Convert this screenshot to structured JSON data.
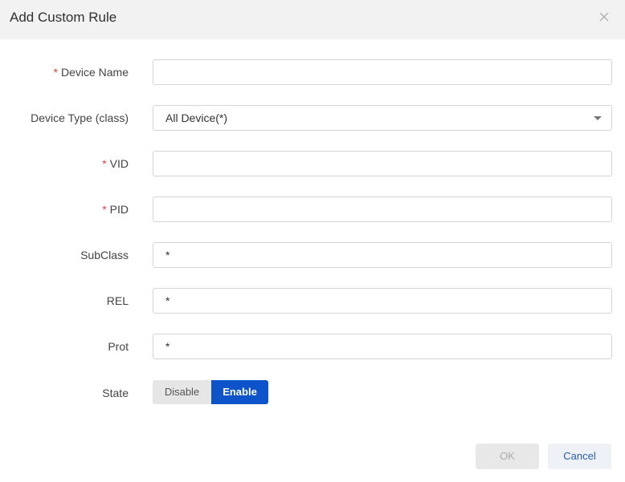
{
  "dialog": {
    "title": "Add Custom Rule"
  },
  "fields": {
    "device_name": {
      "label": "Device Name",
      "required_mark": "*",
      "value": ""
    },
    "device_type": {
      "label": "Device Type (class)",
      "value": "All Device(*)"
    },
    "vid": {
      "label": "VID",
      "required_mark": "*",
      "value": ""
    },
    "pid": {
      "label": "PID",
      "required_mark": "*",
      "value": ""
    },
    "subclass": {
      "label": "SubClass",
      "value": "*"
    },
    "rel": {
      "label": "REL",
      "value": "*"
    },
    "prot": {
      "label": "Prot",
      "value": "*"
    },
    "state": {
      "label": "State",
      "disable_label": "Disable",
      "enable_label": "Enable",
      "selected": "Enable"
    }
  },
  "footer": {
    "ok_label": "OK",
    "cancel_label": "Cancel"
  },
  "colors": {
    "accent": "#0d53c9",
    "required": "#e23d3d"
  }
}
